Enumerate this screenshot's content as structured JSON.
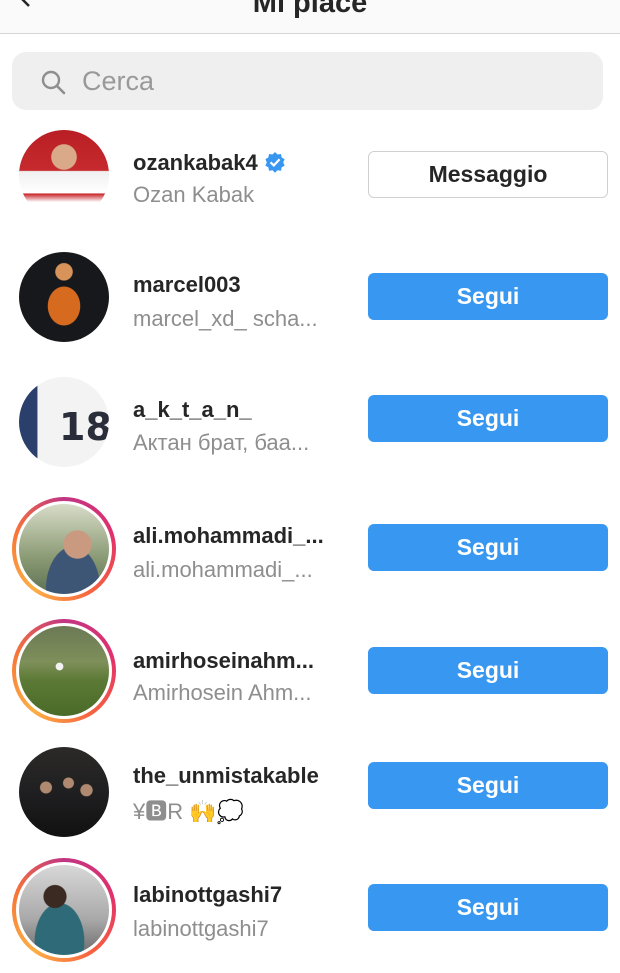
{
  "header": {
    "title": "Mi piace"
  },
  "search": {
    "placeholder": "Cerca"
  },
  "users": [
    {
      "username": "ozankabak4",
      "full_name": "Ozan Kabak",
      "verified": true,
      "button": "Messaggio",
      "story_ring": false
    },
    {
      "username": "marcel003",
      "full_name": "marcel_xd_ scha...",
      "verified": false,
      "button": "Segui",
      "story_ring": false
    },
    {
      "username": "a_k_t_a_n_",
      "full_name": "Актан брат, баа...",
      "verified": false,
      "button": "Segui",
      "story_ring": false
    },
    {
      "username": "ali.mohammadi_...",
      "full_name": "ali.mohammadi_...",
      "verified": false,
      "button": "Segui",
      "story_ring": true
    },
    {
      "username": "amirhoseinahm...",
      "full_name": "Amirhosein Ahm...",
      "verified": false,
      "button": "Segui",
      "story_ring": true
    },
    {
      "username": "the_unmistakable",
      "full_name": "¥🅱R 🙌💭",
      "verified": false,
      "button": "Segui",
      "story_ring": false
    },
    {
      "username": "labinottgashi7",
      "full_name": "labinottgashi7",
      "verified": false,
      "button": "Segui",
      "story_ring": true
    }
  ],
  "colors": {
    "follow_button": "#3897f0",
    "verified_badge": "#3897f0",
    "secondary_text": "#8e8e8e"
  }
}
